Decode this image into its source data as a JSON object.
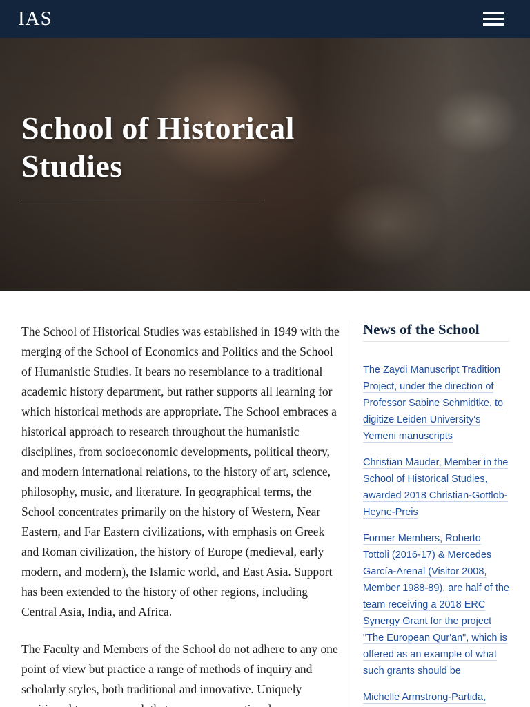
{
  "header": {
    "logo_text": "IAS",
    "menu_icon": "hamburger-menu-icon"
  },
  "hero": {
    "title": "School of Historical Studies"
  },
  "main": {
    "paragraphs": [
      "The School of Historical Studies was established in 1949 with the merging of the School of Economics and Politics and the School of Humanistic Studies.  It bears no resemblance to a traditional academic history department, but rather supports all learning for which historical methods are appropriate.  The School embraces a historical approach to research throughout the humanistic disciplines, from socioeconomic developments, political theory, and modern international relations, to the history of art, science, philosophy, music, and literature.  In geographical terms, the School concentrates primarily on the history of Western, Near Eastern, and Far Eastern civilizations, with emphasis on Greek and Roman civilization, the history of Europe (medieval, early modern, and modern), the Islamic world, and East Asia.  Support has been extended to the history of other regions, including Central Asia, India, and Africa.",
      "The Faculty and Members of the School do not adhere to any one point of view but practice a range of methods of inquiry and scholarly styles, both traditional and innovative.  Uniquely positioned to pursue work that crosses conventional"
    ]
  },
  "sidebar": {
    "title": "News of the School",
    "news": [
      "The Zaydi Manuscript Tradition Project, under the direction of Professor Sabine Schmidtke, to digitize Leiden University's Yemeni manuscripts",
      "Christian Mauder, Member in the School of Historical Studies, awarded 2018 Christian-Gottlob-Heyne-Preis",
      "Former Members, Roberto Tottoli (2016-17) & Mercedes García-Arenal (Visitor 2008, Member 1988-89), are half of the team receiving a 2018 ERC Synergy Grant for the project \"The European Qur'an\", which is offered as an example of what such grants should be",
      "Michelle Armstrong-Partida,"
    ]
  },
  "colors": {
    "header_bg": "#12253d",
    "link": "#1f4f9e",
    "heading": "#12253d"
  }
}
